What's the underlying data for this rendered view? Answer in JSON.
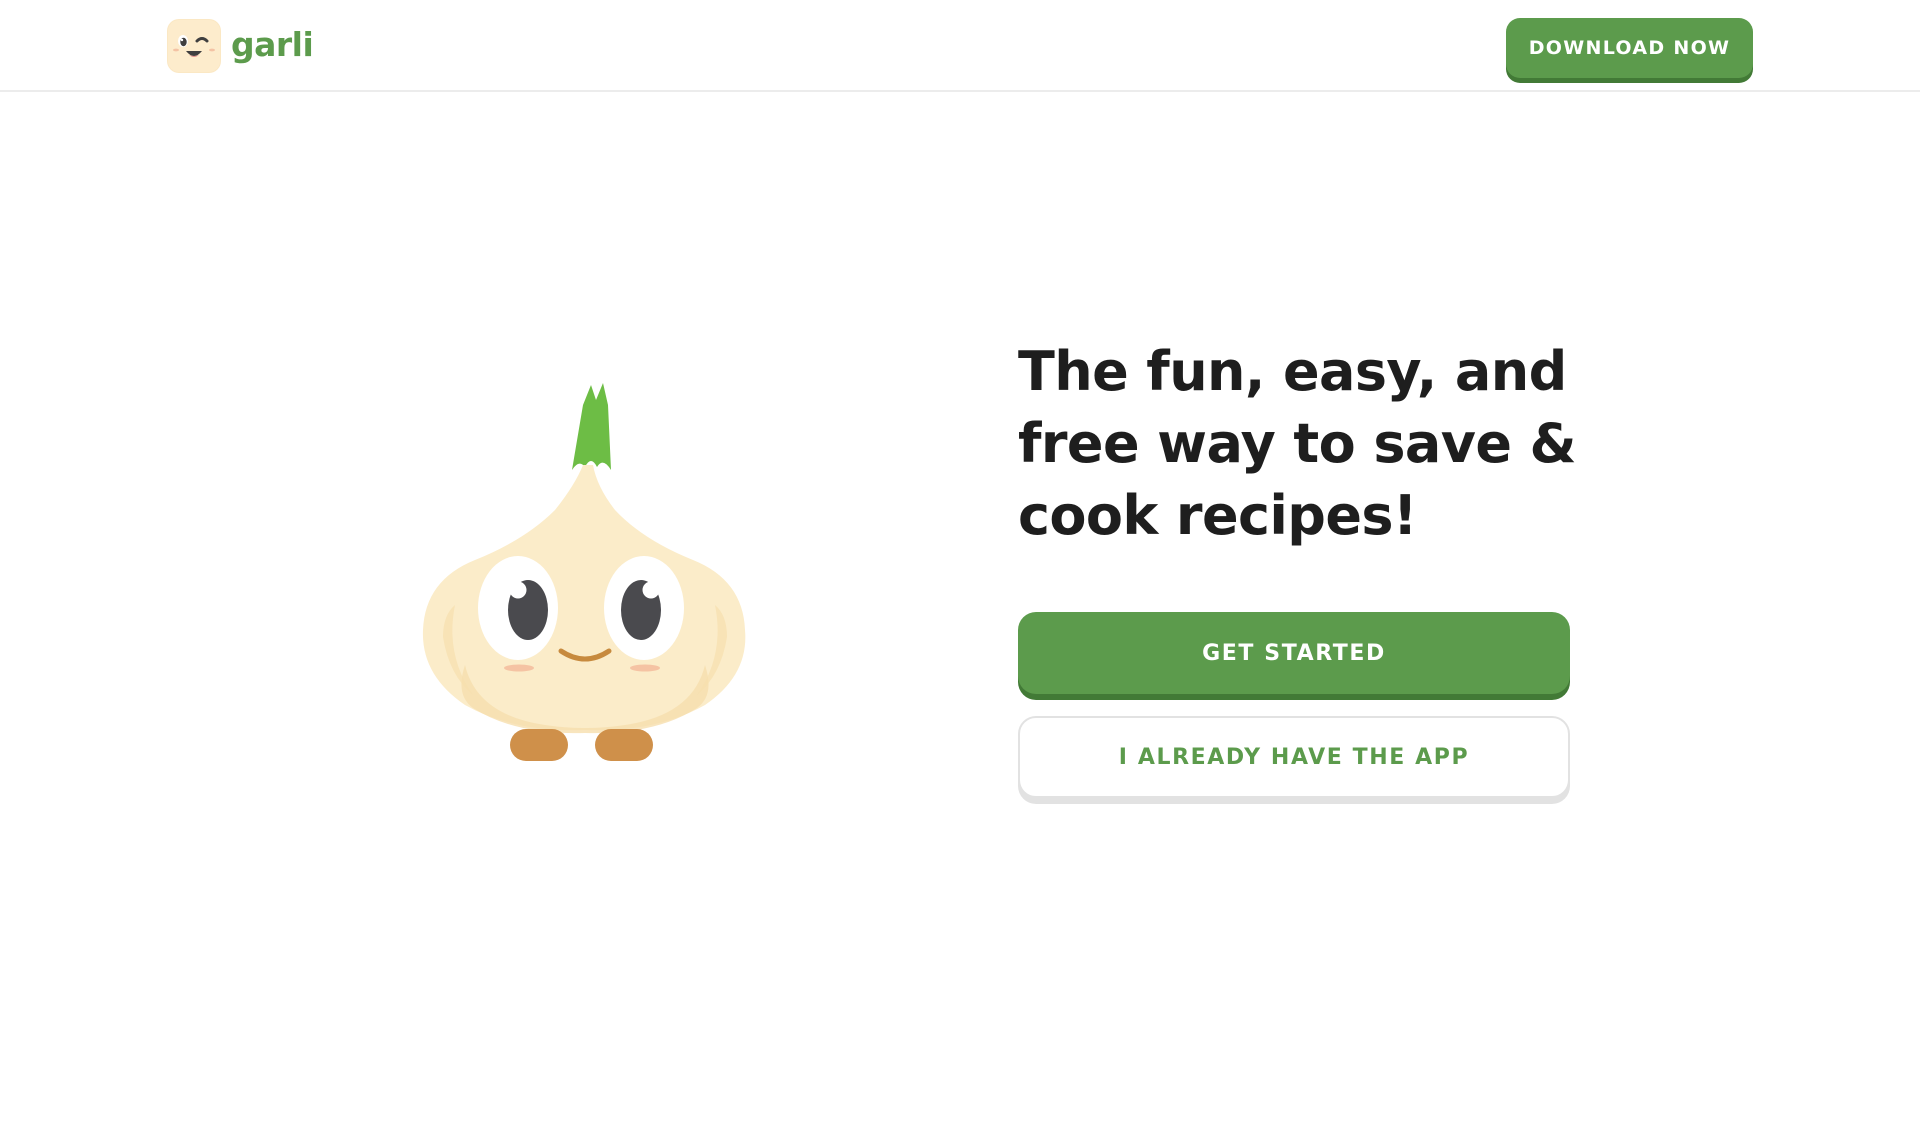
{
  "header": {
    "brand_name": "garli",
    "logo_icon": "garlic-winking-face-icon",
    "download_label": "DOWNLOAD NOW"
  },
  "hero": {
    "mascot_icon": "garlic-mascot-illustration",
    "headline": "The fun, easy, and free way to save & cook recipes!",
    "primary_label": "GET STARTED",
    "secondary_label": "I ALREADY HAVE THE APP"
  },
  "colors": {
    "brand_green": "#5c9b4c",
    "brand_green_shadow": "#427a36",
    "headline_text": "#1e1e1e",
    "garlic_body": "#fbecc9",
    "sprout_green": "#6dbd45",
    "feet_orange": "#cf904a"
  }
}
